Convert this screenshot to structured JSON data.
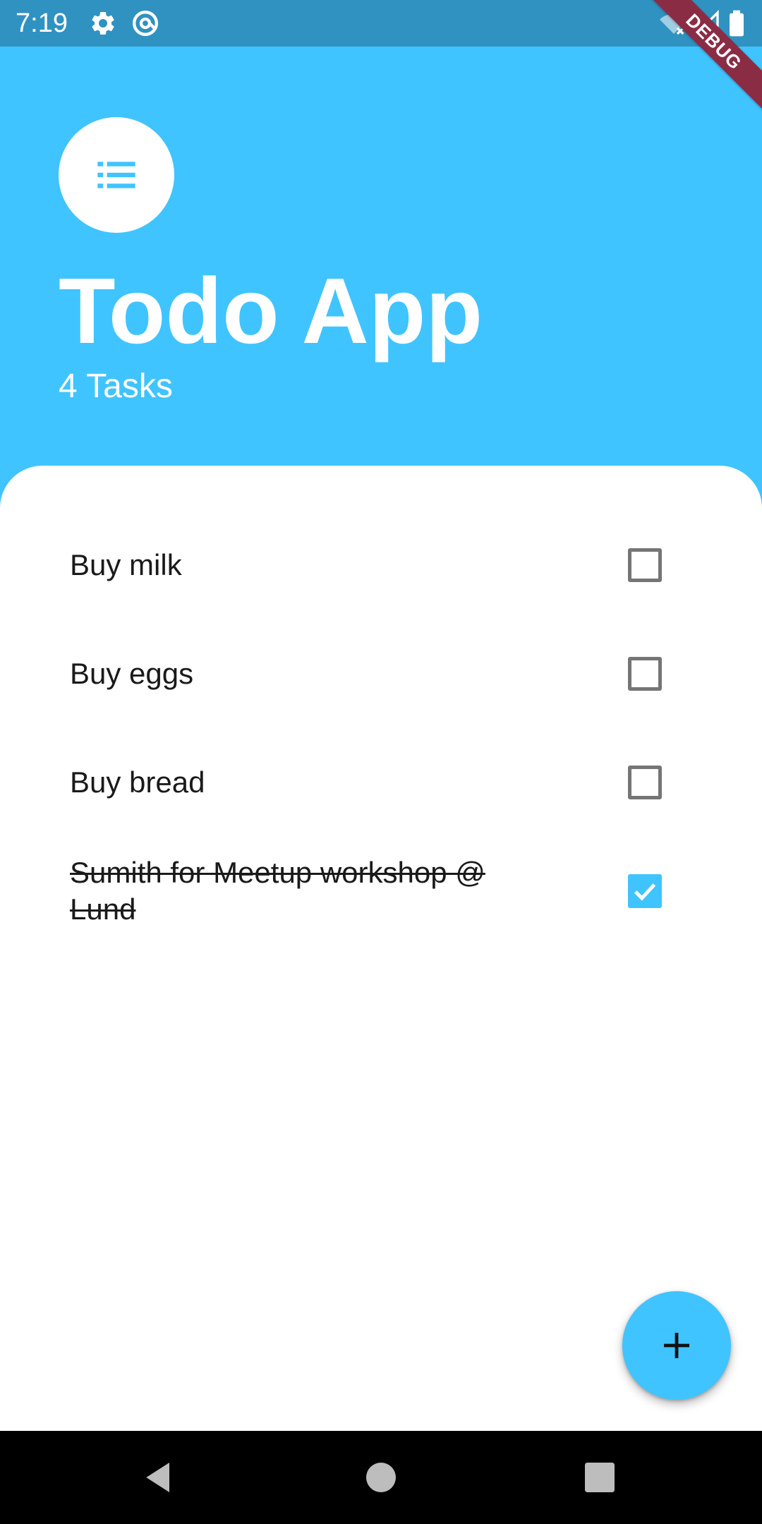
{
  "status_bar": {
    "time": "7:19",
    "icons": [
      "gear-icon",
      "at-sign-icon",
      "wifi-off-icon",
      "cell-signal-icon",
      "battery-icon"
    ]
  },
  "debug_banner": {
    "label": "DEBUG"
  },
  "header": {
    "icon": "list-icon",
    "title": "Todo App",
    "task_count": "4 Tasks"
  },
  "todos": [
    {
      "label": "Buy milk",
      "done": false
    },
    {
      "label": "Buy eggs",
      "done": false
    },
    {
      "label": "Buy bread",
      "done": false
    },
    {
      "label": "Sumith for Meetup workshop @ Lund",
      "done": true
    }
  ],
  "fab": {
    "icon": "plus-icon"
  },
  "nav_bar": {
    "icons": [
      "back-triangle-icon",
      "home-circle-icon",
      "recents-square-icon"
    ]
  },
  "colors": {
    "accent": "#40C4FF",
    "status_bar": "#3092C1",
    "debug_banner": "#8B2C45",
    "checkbox_border": "#757575"
  }
}
